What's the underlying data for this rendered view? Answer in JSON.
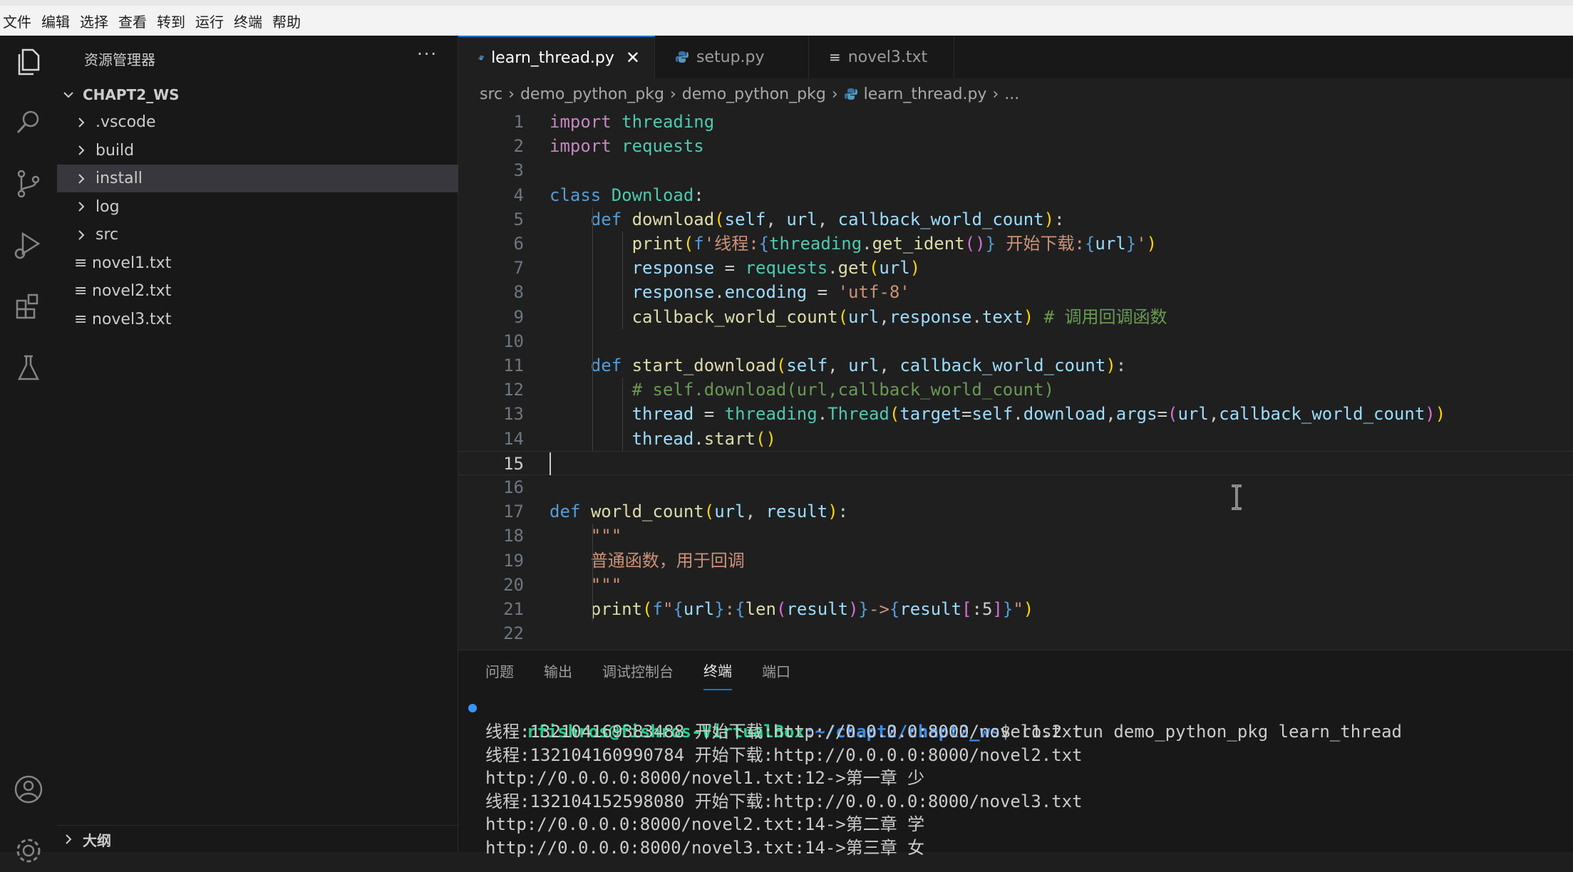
{
  "menubar": [
    "文件",
    "编辑",
    "选择",
    "查看",
    "转到",
    "运行",
    "终端",
    "帮助"
  ],
  "activity_icons": [
    "explorer-icon",
    "search-icon",
    "source-control-icon",
    "run-debug-icon",
    "extensions-icon",
    "testing-icon",
    "account-icon",
    "settings-icon"
  ],
  "sidebar": {
    "title": "资源管理器",
    "more": "···",
    "workspace": "CHAPT2_WS",
    "items": [
      {
        "label": ".vscode",
        "type": "folder"
      },
      {
        "label": "build",
        "type": "folder"
      },
      {
        "label": "install",
        "type": "folder",
        "selected": true
      },
      {
        "label": "log",
        "type": "folder"
      },
      {
        "label": "src",
        "type": "folder"
      },
      {
        "label": "novel1.txt",
        "type": "file"
      },
      {
        "label": "novel2.txt",
        "type": "file"
      },
      {
        "label": "novel3.txt",
        "type": "file"
      }
    ],
    "outline": "大纲"
  },
  "tabs": [
    {
      "label": "learn_thread.py",
      "icon": "python-icon",
      "active": true,
      "close": "✕"
    },
    {
      "label": "setup.py",
      "icon": "python-icon",
      "active": false
    },
    {
      "label": "novel3.txt",
      "icon": "text-file-icon",
      "active": false
    }
  ],
  "breadcrumb": [
    "src",
    "demo_python_pkg",
    "demo_python_pkg",
    "learn_thread.py",
    "..."
  ],
  "breadcrumb_sep": "›",
  "code": {
    "current_line": 15,
    "lines": [
      [
        [
          "kw",
          "import"
        ],
        [
          "ws",
          " "
        ],
        [
          "cls",
          "threading"
        ]
      ],
      [
        [
          "kw",
          "import"
        ],
        [
          "ws",
          " "
        ],
        [
          "cls",
          "requests"
        ]
      ],
      [],
      [
        [
          "kwd",
          "class"
        ],
        [
          "ws",
          " "
        ],
        [
          "cls",
          "Download"
        ],
        [
          "ws",
          ":"
        ]
      ],
      [
        [
          "ws",
          "    "
        ],
        [
          "kwd",
          "def"
        ],
        [
          "ws",
          " "
        ],
        [
          "fn",
          "download"
        ],
        [
          "par",
          "("
        ],
        [
          "var",
          "self"
        ],
        [
          "ws",
          ", "
        ],
        [
          "var",
          "url"
        ],
        [
          "ws",
          ", "
        ],
        [
          "var",
          "callback_world_count"
        ],
        [
          "par",
          ")"
        ],
        [
          "ws",
          ":"
        ]
      ],
      [
        [
          "ws",
          "        "
        ],
        [
          "fn",
          "print"
        ],
        [
          "par",
          "("
        ],
        [
          "kwd",
          "f"
        ],
        [
          "str",
          "'线程:"
        ],
        [
          "kwd",
          "{"
        ],
        [
          "cls",
          "threading"
        ],
        [
          "ws",
          "."
        ],
        [
          "fn",
          "get_ident"
        ],
        [
          "par2",
          "()"
        ],
        [
          "kwd",
          "}"
        ],
        [
          "str",
          " 开始下载:"
        ],
        [
          "kwd",
          "{"
        ],
        [
          "var",
          "url"
        ],
        [
          "kwd",
          "}"
        ],
        [
          "str",
          "'"
        ],
        [
          "par",
          ")"
        ]
      ],
      [
        [
          "ws",
          "        "
        ],
        [
          "var",
          "response"
        ],
        [
          "ws",
          " = "
        ],
        [
          "cls",
          "requests"
        ],
        [
          "ws",
          "."
        ],
        [
          "fn",
          "get"
        ],
        [
          "par",
          "("
        ],
        [
          "var",
          "url"
        ],
        [
          "par",
          ")"
        ]
      ],
      [
        [
          "ws",
          "        "
        ],
        [
          "var",
          "response"
        ],
        [
          "ws",
          "."
        ],
        [
          "var",
          "encoding"
        ],
        [
          "ws",
          " = "
        ],
        [
          "str",
          "'utf-8'"
        ]
      ],
      [
        [
          "ws",
          "        "
        ],
        [
          "fn",
          "callback_world_count"
        ],
        [
          "par",
          "("
        ],
        [
          "var",
          "url"
        ],
        [
          "ws",
          ","
        ],
        [
          "var",
          "response"
        ],
        [
          "ws",
          "."
        ],
        [
          "var",
          "text"
        ],
        [
          "par",
          ")"
        ],
        [
          "ws",
          " "
        ],
        [
          "cmt",
          "# 调用回调函数"
        ]
      ],
      [],
      [
        [
          "ws",
          "    "
        ],
        [
          "kwd",
          "def"
        ],
        [
          "ws",
          " "
        ],
        [
          "fn",
          "start_download"
        ],
        [
          "par",
          "("
        ],
        [
          "var",
          "self"
        ],
        [
          "ws",
          ", "
        ],
        [
          "var",
          "url"
        ],
        [
          "ws",
          ", "
        ],
        [
          "var",
          "callback_world_count"
        ],
        [
          "par",
          ")"
        ],
        [
          "ws",
          ":"
        ]
      ],
      [
        [
          "ws",
          "        "
        ],
        [
          "cmt",
          "# self.download(url,callback_world_count)"
        ]
      ],
      [
        [
          "ws",
          "        "
        ],
        [
          "var",
          "thread"
        ],
        [
          "ws",
          " = "
        ],
        [
          "cls",
          "threading"
        ],
        [
          "ws",
          "."
        ],
        [
          "cls",
          "Thread"
        ],
        [
          "par",
          "("
        ],
        [
          "var",
          "target"
        ],
        [
          "ws",
          "="
        ],
        [
          "var",
          "self"
        ],
        [
          "ws",
          "."
        ],
        [
          "var",
          "download"
        ],
        [
          "ws",
          ","
        ],
        [
          "var",
          "args"
        ],
        [
          "ws",
          "="
        ],
        [
          "par2",
          "("
        ],
        [
          "var",
          "url"
        ],
        [
          "ws",
          ","
        ],
        [
          "var",
          "callback_world_count"
        ],
        [
          "par2",
          ")"
        ],
        [
          "par",
          ")"
        ]
      ],
      [
        [
          "ws",
          "        "
        ],
        [
          "var",
          "thread"
        ],
        [
          "ws",
          "."
        ],
        [
          "fn",
          "start"
        ],
        [
          "par",
          "()"
        ]
      ],
      [],
      [],
      [
        [
          "kwd",
          "def"
        ],
        [
          "ws",
          " "
        ],
        [
          "fn",
          "world_count"
        ],
        [
          "par",
          "("
        ],
        [
          "var",
          "url"
        ],
        [
          "ws",
          ", "
        ],
        [
          "var",
          "result"
        ],
        [
          "par",
          ")"
        ],
        [
          "ws",
          ":"
        ]
      ],
      [
        [
          "ws",
          "    "
        ],
        [
          "str",
          "\"\"\""
        ]
      ],
      [
        [
          "ws",
          "    "
        ],
        [
          "str",
          "普通函数，用于回调"
        ]
      ],
      [
        [
          "ws",
          "    "
        ],
        [
          "str",
          "\"\"\""
        ]
      ],
      [
        [
          "ws",
          "    "
        ],
        [
          "fn",
          "print"
        ],
        [
          "par",
          "("
        ],
        [
          "kwd",
          "f"
        ],
        [
          "str",
          "\""
        ],
        [
          "kwd",
          "{"
        ],
        [
          "var",
          "url"
        ],
        [
          "kwd",
          "}"
        ],
        [
          "str",
          ":"
        ],
        [
          "kwd",
          "{"
        ],
        [
          "fn",
          "len"
        ],
        [
          "par2",
          "("
        ],
        [
          "var",
          "result"
        ],
        [
          "par2",
          ")"
        ],
        [
          "kwd",
          "}"
        ],
        [
          "str",
          "->"
        ],
        [
          "kwd",
          "{"
        ],
        [
          "var",
          "result"
        ],
        [
          "par2",
          "["
        ],
        [
          "ws",
          ":5"
        ],
        [
          "par2",
          "]"
        ],
        [
          "kwd",
          "}"
        ],
        [
          "str",
          "\""
        ],
        [
          "par",
          ")"
        ]
      ],
      []
    ]
  },
  "panel": {
    "tabs": [
      {
        "label": "问题",
        "active": false
      },
      {
        "label": "输出",
        "active": false
      },
      {
        "label": "调试控制台",
        "active": false
      },
      {
        "label": "终端",
        "active": true
      },
      {
        "label": "端口",
        "active": false
      }
    ],
    "prompt_user": "rfishros@fishros-VirtualBox",
    "prompt_path": ":~/chapt2/chapt2_ws",
    "prompt_cmd": "$ ros2 run demo_python_pkg learn_thread",
    "output": [
      "线程:132104169383488 开始下载:http://0.0.0.0:8000/novel1.txt",
      "线程:132104160990784 开始下载:http://0.0.0.0:8000/novel2.txt",
      "http://0.0.0.0:8000/novel1.txt:12->第一章 少",
      "线程:132104152598080 开始下载:http://0.0.0.0:8000/novel3.txt",
      "http://0.0.0.0:8000/novel2.txt:14->第二章 学",
      "http://0.0.0.0:8000/novel3.txt:14->第三章 女"
    ]
  }
}
